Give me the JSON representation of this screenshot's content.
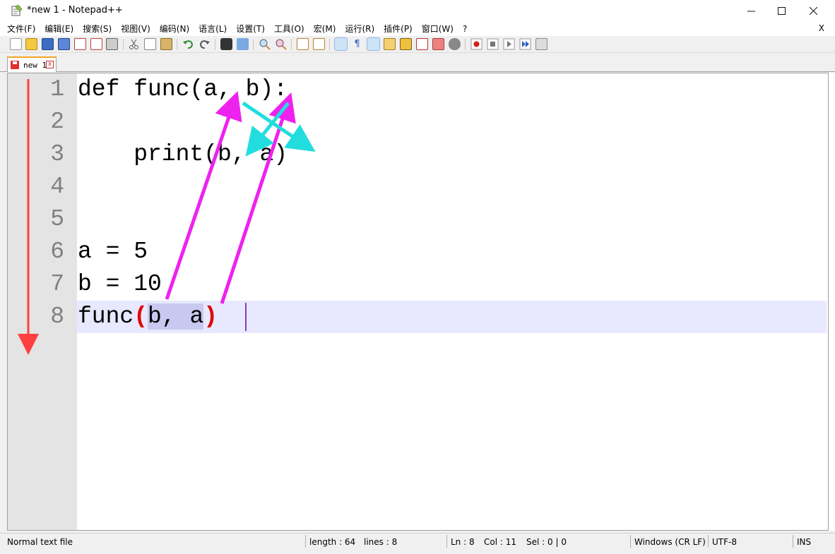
{
  "window": {
    "title": "*new 1 - Notepad++",
    "minimize": "—",
    "maximize": "☐",
    "close": "✕"
  },
  "menu": {
    "items": [
      "文件(F)",
      "编辑(E)",
      "搜索(S)",
      "视图(V)",
      "编码(N)",
      "语言(L)",
      "设置(T)",
      "工具(O)",
      "宏(M)",
      "运行(R)",
      "插件(P)",
      "窗口(W)",
      "?"
    ],
    "close_doc": "X"
  },
  "tab": {
    "label": "new 1",
    "close_icon": "x"
  },
  "editor": {
    "line_numbers": [
      "1",
      "2",
      "3",
      "4",
      "5",
      "6",
      "7",
      "8"
    ],
    "lines": [
      "def func(a, b):",
      "",
      "    print(b, a)",
      "",
      "",
      "a = 5",
      "b = 10",
      "func(b, a)"
    ],
    "line8": {
      "func": "func",
      "open_paren": "(",
      "args": "b, a",
      "close_paren": ")"
    }
  },
  "status": {
    "file_type": "Normal text file",
    "length": "length : 64",
    "lines": "lines : 8",
    "ln": "Ln : 8",
    "col": "Col : 11",
    "sel": "Sel : 0 | 0",
    "eol": "Windows (CR LF)",
    "encoding": "UTF-8",
    "mode": "INS"
  },
  "colors": {
    "red_arrow": "#ff4040",
    "magenta_arrow": "#ee22ee",
    "cyan_arrow": "#22dddd",
    "current_line_bg": "#e8e8ff",
    "brace_match": "#e00000"
  }
}
